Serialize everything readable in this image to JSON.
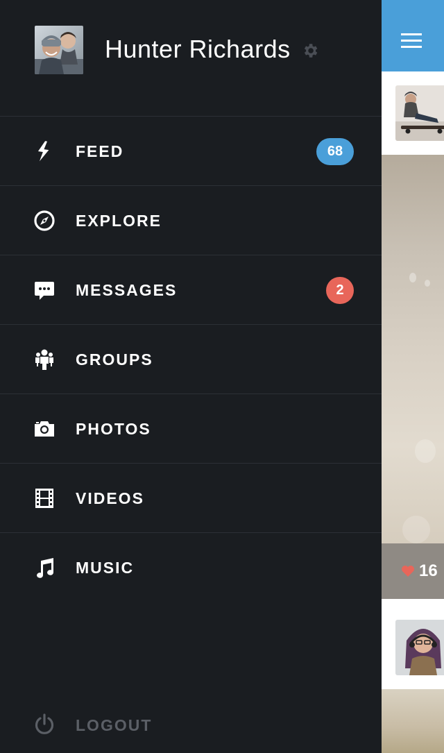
{
  "profile": {
    "name": "Hunter Richards",
    "avatar_icon": "user-avatar-photo",
    "settings_icon": "gear-icon"
  },
  "menu": {
    "items": [
      {
        "label": "FEED",
        "icon": "lightning-icon",
        "badge": "68",
        "badge_color": "#4a9fd9"
      },
      {
        "label": "EXPLORE",
        "icon": "compass-icon"
      },
      {
        "label": "MESSAGES",
        "icon": "chat-bubble-icon",
        "badge": "2",
        "badge_color": "#e8665a"
      },
      {
        "label": "GROUPS",
        "icon": "people-icon"
      },
      {
        "label": "PHOTOS",
        "icon": "camera-icon"
      },
      {
        "label": "VIDEOS",
        "icon": "film-icon"
      },
      {
        "label": "MUSIC",
        "icon": "music-note-icon"
      }
    ],
    "logout_label": "LOGOUT",
    "logout_icon": "power-icon"
  },
  "content": {
    "menu_icon": "hamburger-icon",
    "likes": "16",
    "like_icon": "heart-icon"
  },
  "colors": {
    "drawer_bg": "#1a1d21",
    "accent_blue": "#4a9fd9",
    "alert_red": "#e8665a",
    "divider": "#2c3036",
    "logout_text": "#5b5f66"
  }
}
